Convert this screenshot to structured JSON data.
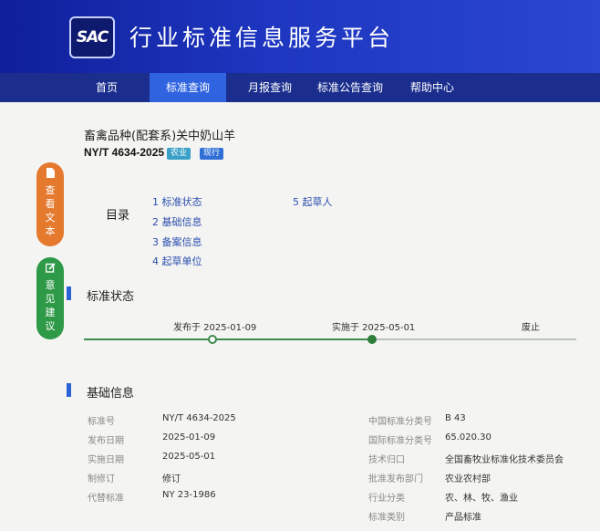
{
  "header": {
    "logo_text": "SAC",
    "site_title": "行业标准信息服务平台"
  },
  "nav": {
    "items": [
      {
        "label": "首页"
      },
      {
        "label": "标准查询"
      },
      {
        "label": "月报查询"
      },
      {
        "label": "标准公告查询"
      },
      {
        "label": "帮助中心"
      }
    ],
    "active_index": 1
  },
  "standard": {
    "name": "畜禽品种(配套系)关中奶山羊",
    "code": "NY/T 4634-2025",
    "category_tag": "农业",
    "status_tag": "现行"
  },
  "side_buttons": {
    "view_text": {
      "icon": "document-icon",
      "label": "查看文本"
    },
    "comment": {
      "icon": "edit-icon",
      "label": "意见建议"
    }
  },
  "toc": {
    "title": "目录",
    "items": [
      {
        "num": "1",
        "label": "标准状态"
      },
      {
        "num": "2",
        "label": "基础信息"
      },
      {
        "num": "3",
        "label": "备案信息"
      },
      {
        "num": "4",
        "label": "起草单位"
      },
      {
        "num": "5",
        "label": "起草人"
      }
    ]
  },
  "status_section": {
    "title": "标准状态",
    "published": "发布于 2025-01-09",
    "implemented": "实施于 2025-05-01",
    "abolished": "废止"
  },
  "basic_section": {
    "title": "基础信息",
    "left": [
      {
        "key": "标准号",
        "value": "NY/T 4634-2025"
      },
      {
        "key": "发布日期",
        "value": "2025-01-09"
      },
      {
        "key": "实施日期",
        "value": "2025-05-01"
      },
      {
        "key": "制修订",
        "value": "修订"
      },
      {
        "key": "代替标准",
        "value": "NY 23-1986"
      }
    ],
    "right": [
      {
        "key": "中国标准分类号",
        "value": "B 43"
      },
      {
        "key": "国际标准分类号",
        "value": "65.020.30"
      },
      {
        "key": "技术归口",
        "value": "全国畜牧业标准化技术委员会"
      },
      {
        "key": "批准发布部门",
        "value": "农业农村部"
      },
      {
        "key": "行业分类",
        "value": "农、林、牧、渔业"
      },
      {
        "key": "标准类别",
        "value": "产品标准"
      }
    ]
  },
  "colors": {
    "header": "#1e36c0",
    "nav": "#1b2e8e",
    "nav_active": "#2f63e0",
    "accent": "#2c63d4",
    "timeline": "#3f8a4e",
    "view_btn": "#e57a2e",
    "comment_btn": "#2e9a48"
  }
}
